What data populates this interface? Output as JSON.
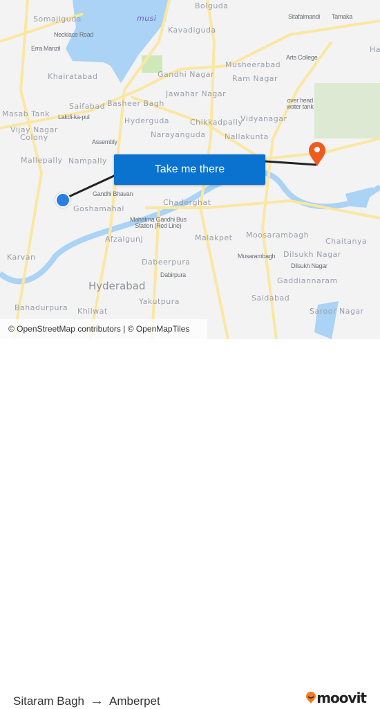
{
  "map": {
    "labels": [
      "Somajiguda",
      "Necklace Road",
      "Erra Manzil",
      "musi",
      "Khairatabad",
      "Saifabad",
      "Basheer Bagh",
      "Masab Tank",
      "Lakdi-ka-pul",
      "Hyderguda",
      "Vijay Nagar\nColony",
      "Assembly",
      "Narayanguda",
      "Mallepally",
      "Nampally",
      "Bolguda",
      "Kavadiguda",
      "Sitafalmandi",
      "Tarnaka",
      "Arts College",
      "Gandhi Nagar",
      "Musheerabad",
      "Ram Nagar",
      "Jawahar Nagar",
      "over head\nwater tank",
      "Vidyanagar",
      "Chikkadpally",
      "Nallakunta",
      "Gandhi Bhavan",
      "Goshamahal",
      "Chaderghat",
      "Mahatma Gandhi Bus\nStation (Red Line)",
      "Afzalgunj",
      "Malakpet",
      "Moosarambagh",
      "Chaitanya",
      "Karvan",
      "Musarambagh",
      "Dilsukh Nagar",
      "Dilsukh Nagar",
      "Dabeerpura",
      "Dabirpura",
      "Gaddiannaram",
      "Hyderabad",
      "Yakutpura",
      "Saidabad",
      "Bahadurpura",
      "Khilwat",
      "Saroor Nagar",
      "Hab"
    ],
    "origin_marker": "origin-dot",
    "destination_marker": "destination-pin-icon",
    "cta_label": "Take me there",
    "attribution": "© OpenStreetMap contributors | © OpenMapTiles",
    "colors": {
      "water": "#aad3f5",
      "road": "#fbe7a1",
      "park": "#cfe8b8",
      "route": "#222222",
      "cta": "#0a72cf",
      "origin": "#2a7de1",
      "destination": "#f05a1e"
    }
  },
  "footer": {
    "from": "Sitaram Bagh",
    "arrow": "→",
    "to": "Amberpet",
    "brand": "moovit"
  }
}
